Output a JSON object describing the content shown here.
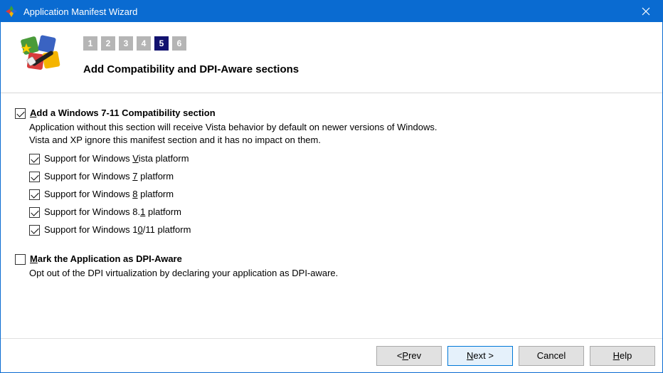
{
  "window": {
    "title": "Application Manifest Wizard"
  },
  "wizard": {
    "steps": [
      "1",
      "2",
      "3",
      "4",
      "5",
      "6"
    ],
    "current_step_index": 4,
    "page_title": "Add Compatibility and DPI-Aware sections"
  },
  "compat": {
    "checked": true,
    "label_prefix": "",
    "label_u": "A",
    "label_rest": "dd a Windows 7-11 Compatibility section",
    "desc_line1": "Application without this section will receive Vista behavior by default on newer versions of Windows.",
    "desc_line2": "Vista and XP ignore this manifest section and it has no impact on them.",
    "items": [
      {
        "checked": true,
        "pre": "Support for Windows ",
        "u": "V",
        "post": "ista platform"
      },
      {
        "checked": true,
        "pre": "Support for Windows ",
        "u": "7",
        "post": " platform"
      },
      {
        "checked": true,
        "pre": "Support for Windows ",
        "u": "8",
        "post": " platform"
      },
      {
        "checked": true,
        "pre": "Support for Windows 8.",
        "u": "1",
        "post": " platform"
      },
      {
        "checked": true,
        "pre": "Support for Windows 1",
        "u": "0",
        "post": "/11 platform"
      }
    ]
  },
  "dpi": {
    "checked": false,
    "label_u": "M",
    "label_rest": "ark the Application as DPI-Aware",
    "desc": "Opt out of the DPI virtualization by declaring your application as DPI-aware."
  },
  "buttons": {
    "prev_pre": "< ",
    "prev_u": "P",
    "prev_post": "rev",
    "next_u": "N",
    "next_post": "ext >",
    "cancel": "Cancel",
    "help_u": "H",
    "help_post": "elp"
  }
}
